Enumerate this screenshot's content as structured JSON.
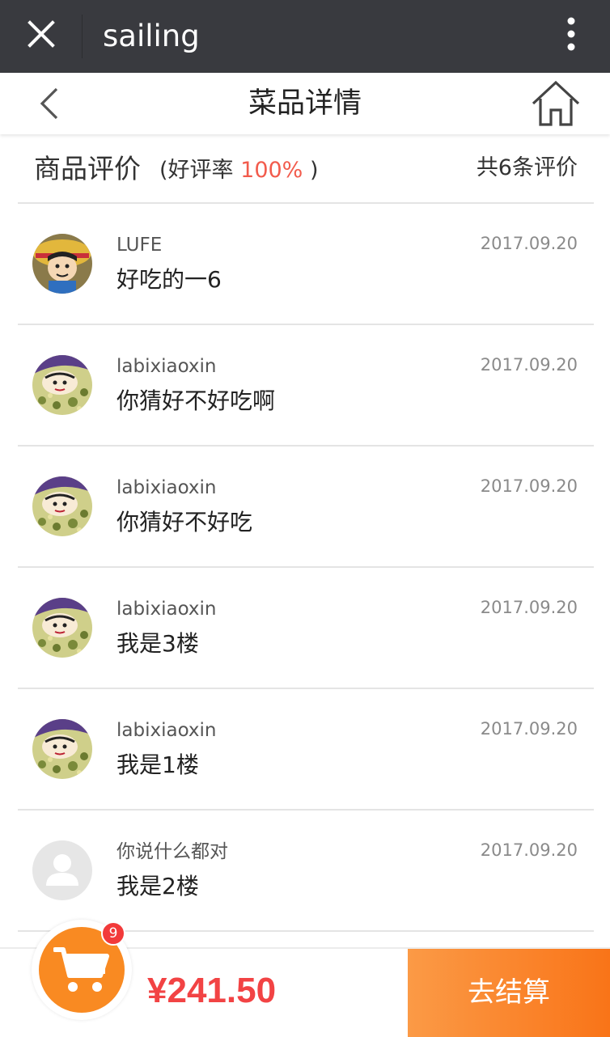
{
  "window": {
    "title": "sailing"
  },
  "header": {
    "title": "菜品详情"
  },
  "summary": {
    "title": "商品评价",
    "rate_prefix": "(好评率",
    "rate_value": "100%",
    "rate_suffix": ")",
    "count_text": "共6条评价"
  },
  "reviews": [
    {
      "user": "LUFE",
      "content": "好吃的一6",
      "date": "2017.09.20",
      "avatar": "luffy-avatar"
    },
    {
      "user": "labixiaoxin",
      "content": "你猜好不好吃啊",
      "date": "2017.09.20",
      "avatar": "crayon-shin-chan-avatar"
    },
    {
      "user": "labixiaoxin",
      "content": "你猜好不好吃",
      "date": "2017.09.20",
      "avatar": "crayon-shin-chan-avatar"
    },
    {
      "user": "labixiaoxin",
      "content": "我是3楼",
      "date": "2017.09.20",
      "avatar": "crayon-shin-chan-avatar"
    },
    {
      "user": "labixiaoxin",
      "content": "我是1楼",
      "date": "2017.09.20",
      "avatar": "crayon-shin-chan-avatar"
    },
    {
      "user": "你说什么都对",
      "content": "我是2楼",
      "date": "2017.09.20",
      "avatar": "default-user-avatar"
    }
  ],
  "cart": {
    "badge_count": "9",
    "total": "¥241.50",
    "checkout_label": "去结算"
  },
  "colors": {
    "topbar": "#393a3f",
    "accent_red": "#f25b4c",
    "price_red": "#f24344",
    "checkout_orange": "#f97418",
    "cart_orange": "#f98a22"
  }
}
